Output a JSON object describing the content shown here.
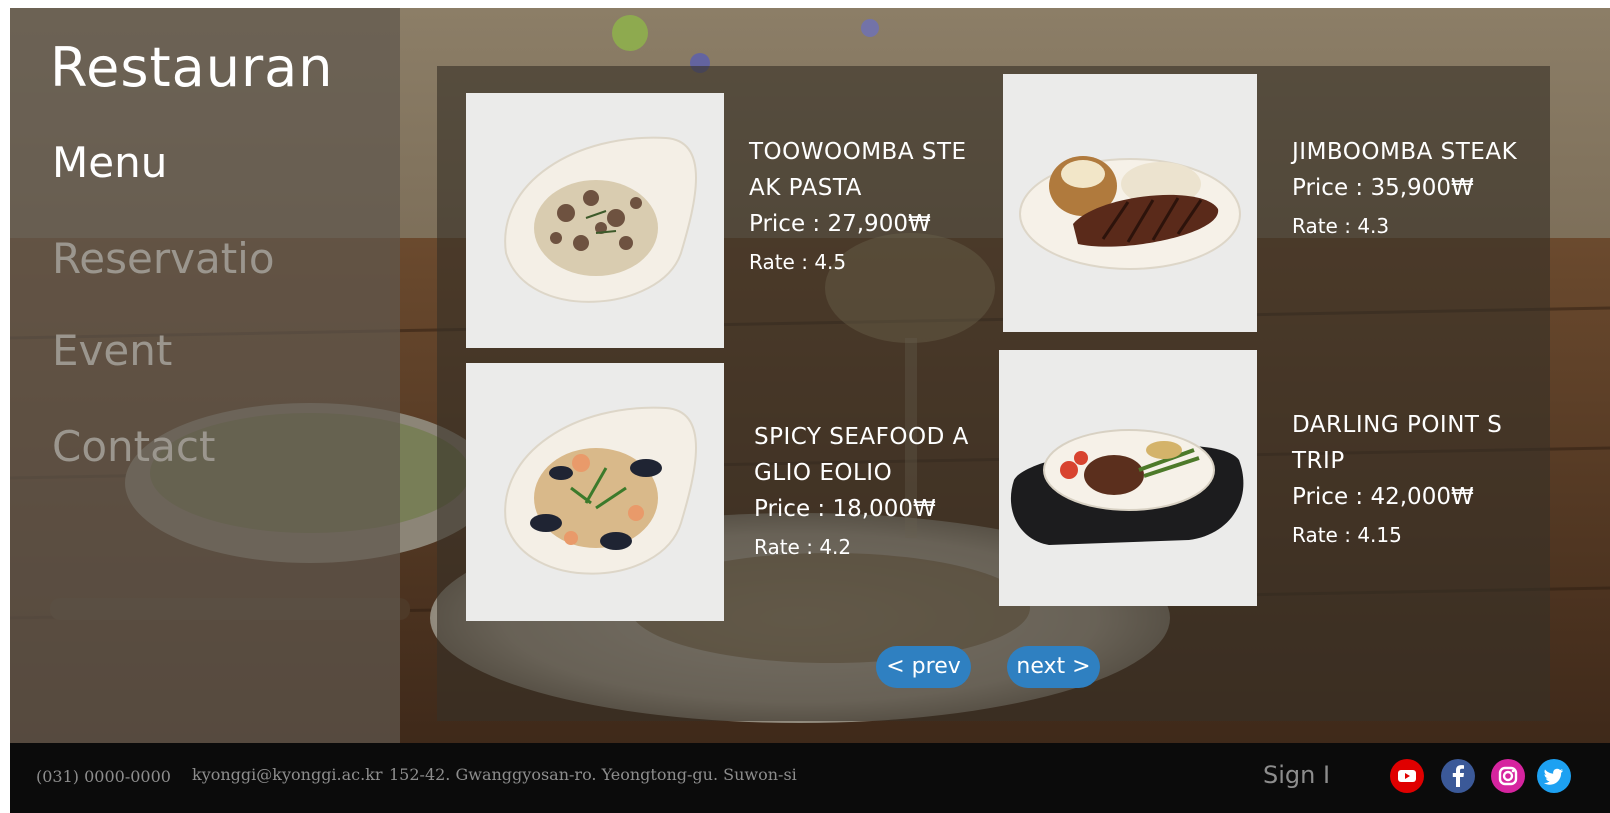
{
  "brand": {
    "title": "Restauran"
  },
  "nav": {
    "items": [
      {
        "label": "Menu",
        "active": true
      },
      {
        "label": "Reservatio",
        "active": false
      },
      {
        "label": "Event",
        "active": false
      },
      {
        "label": "Contact",
        "active": false
      }
    ]
  },
  "menu": {
    "items": [
      {
        "name_line1": "TOOWOOMBA STE",
        "name_line2": "AK PASTA",
        "price": "Price : 27,900₩",
        "rate": "Rate : 4.5",
        "image": "creamy-steak-pasta"
      },
      {
        "name_line1": "JIMBOOMBA STEAK",
        "name_line2": "",
        "price": "Price : 35,900₩",
        "rate": "Rate : 4.3",
        "image": "steak-with-potato-and-rice"
      },
      {
        "name_line1": "SPICY SEAFOOD A",
        "name_line2": "GLIO EOLIO",
        "price": "Price : 18,000₩",
        "rate": "Rate : 4.2",
        "image": "seafood-pasta-with-mussels"
      },
      {
        "name_line1": "DARLING POINT S",
        "name_line2": "TRIP",
        "price": "Price : 42,000₩",
        "rate": "Rate : 4.15",
        "image": "steak-on-sizzling-plate"
      }
    ]
  },
  "pager": {
    "prev_label": "< prev",
    "next_label": "next >"
  },
  "footer": {
    "phone": "(031) 0000-0000",
    "email": "kyonggi@kyonggi.ac.kr",
    "address": "152-42. Gwanggyosan-ro. Yeongtong-gu. Suwon-si",
    "signin_label": "Sign I",
    "social": [
      {
        "icon": "youtube-icon",
        "color": "#e00000"
      },
      {
        "icon": "facebook-icon",
        "color": "#3b5998"
      },
      {
        "icon": "instagram-icon",
        "color": "#d6249f"
      },
      {
        "icon": "twitter-icon",
        "color": "#1da1f2"
      }
    ]
  }
}
